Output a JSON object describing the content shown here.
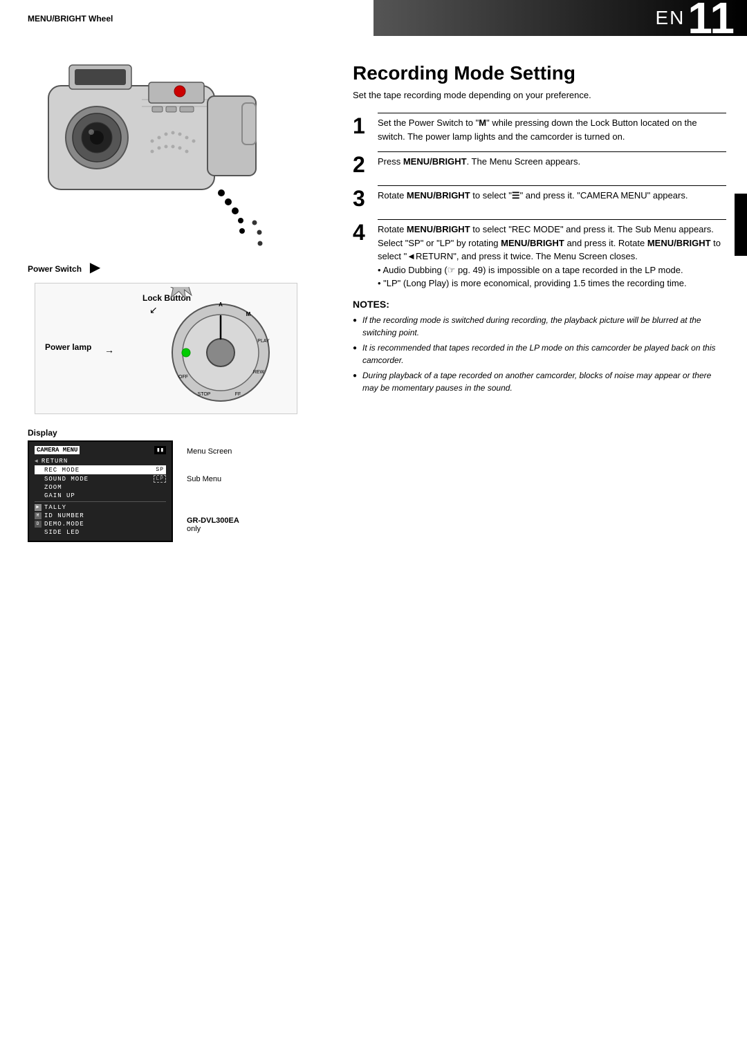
{
  "header": {
    "en_label": "EN",
    "page_num": "11"
  },
  "left": {
    "menu_bright_label": "MENU/BRIGHT Wheel",
    "power_switch_label": "Power Switch",
    "lock_button_label": "Lock Button",
    "power_lamp_label": "Power lamp",
    "display_label": "Display",
    "menu_screen_label": "Menu Screen",
    "sub_menu_label": "Sub Menu",
    "model_label": "GR-DVL300EA",
    "model_suffix": "only",
    "screen": {
      "title": "CAMERA MENU",
      "items": [
        {
          "icon": "",
          "text": "◄RETURN",
          "value": ""
        },
        {
          "icon": "",
          "text": "REC MODE",
          "value": "SP",
          "highlighted": true
        },
        {
          "icon": "",
          "text": "SOUND MODE",
          "value": "LP",
          "dashed": true
        },
        {
          "icon": "",
          "text": "ZOOM",
          "value": ""
        },
        {
          "icon": "",
          "text": "GAIN UP",
          "value": ""
        },
        {
          "icon": "",
          "text": "TALLY",
          "value": ""
        },
        {
          "icon": "",
          "text": "ID NUMBER",
          "value": ""
        },
        {
          "icon": "",
          "text": "DEMO.MODE",
          "value": ""
        },
        {
          "icon": "",
          "text": "SIDE LED",
          "value": ""
        }
      ]
    }
  },
  "right": {
    "title": "Recording Mode Setting",
    "subtitle": "Set the tape recording mode depending on your preference.",
    "steps": [
      {
        "num": "1",
        "html": "Set the Power Switch to “<b>M</b>” while pressing down the Lock Button located on the switch. The power lamp lights and the camcorder is turned on."
      },
      {
        "num": "2",
        "html": "Press <b>MENU/BRIGHT</b>. The Menu Screen appears."
      },
      {
        "num": "3",
        "html": "Rotate <b>MENU/BRIGHT</b> to select “<b>📷</b>” and press it. “CAMERA MENU” appears."
      },
      {
        "num": "4",
        "html": "Rotate <b>MENU/BRIGHT</b> to select “REC MODE” and press it. The Sub Menu appears. Select “SP” or “LP” by rotating <b>MENU/BRIGHT</b> and press it. Rotate <b>MENU/BRIGHT</b> to select “◄RETURN”, and press it twice. The Menu Screen closes.\n• Audio Dubbing (☞ pg. 49) is impossible on a tape recorded in the LP mode.\n• “LP” (Long Play) is more economical, providing 1.5 times the recording time."
      }
    ],
    "notes_title": "NOTES:",
    "notes": [
      "If the recording mode is switched during recording, the playback picture will be blurred at the switching point.",
      "It is recommended that tapes recorded in the LP mode on this camcorder be played back on this camcorder.",
      "During playback of a tape recorded on another camcorder, blocks of noise may appear or there may be momentary pauses in the sound."
    ]
  }
}
